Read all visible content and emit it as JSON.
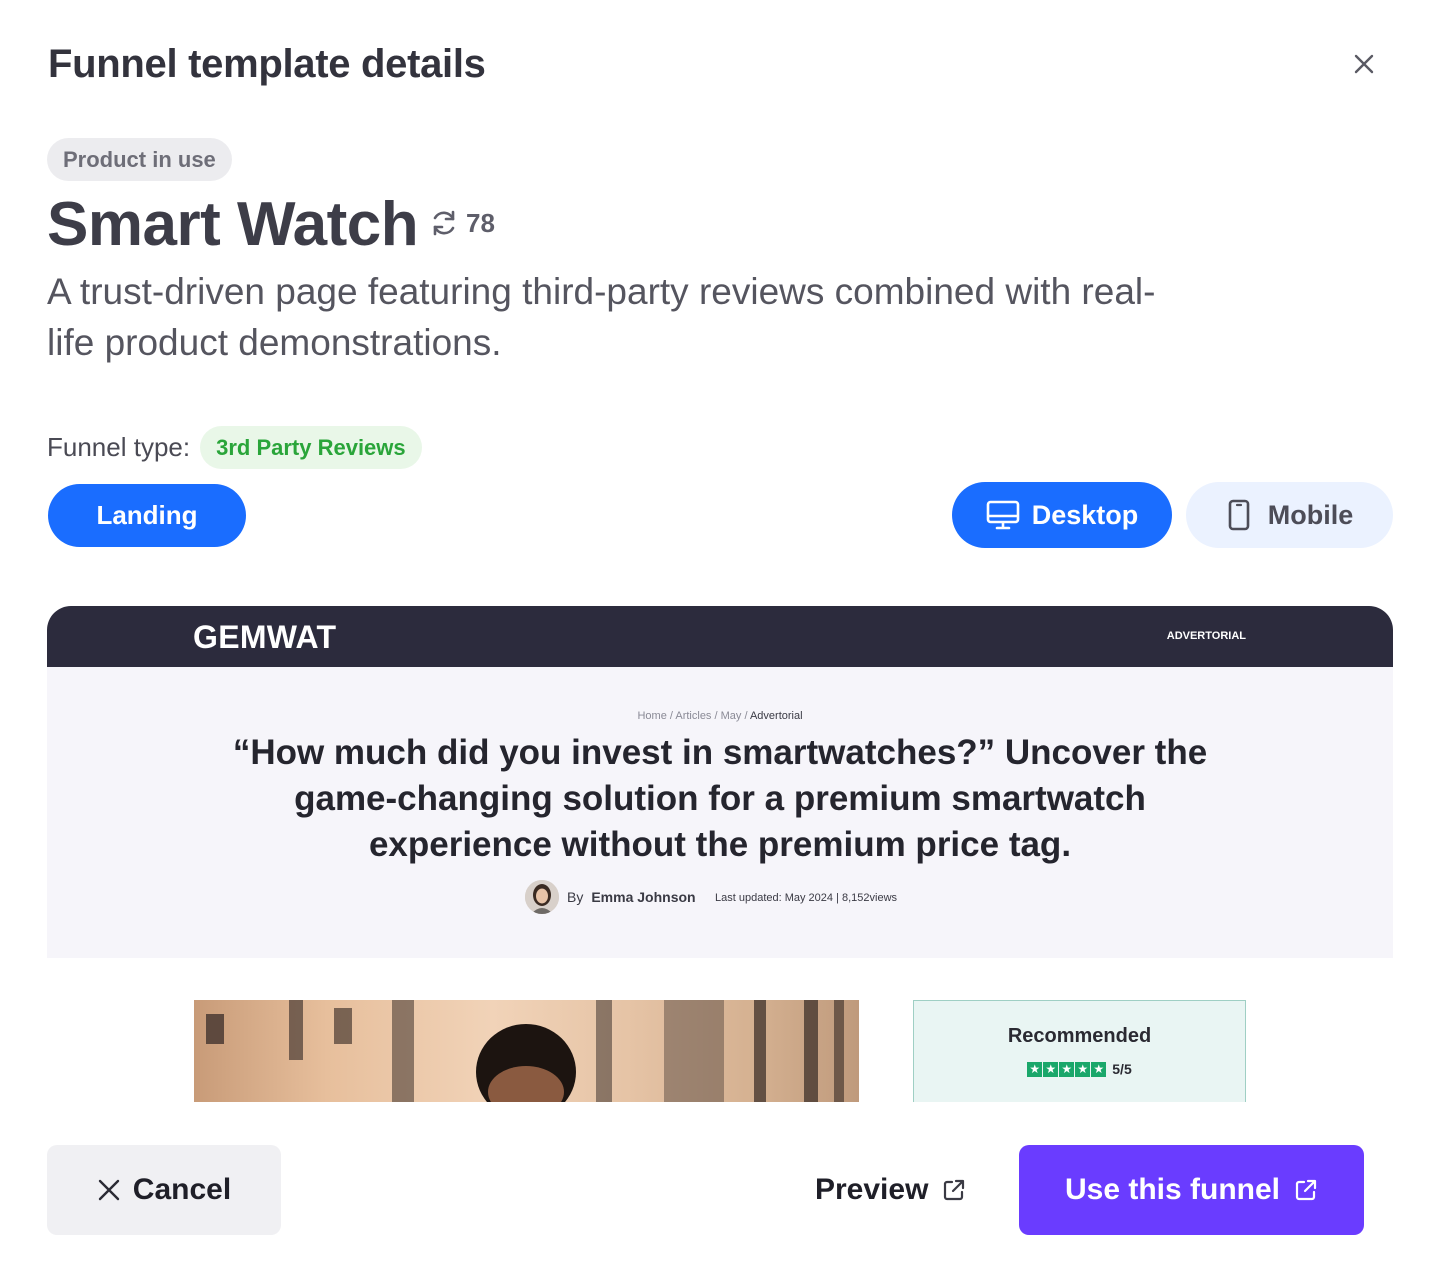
{
  "header": {
    "title": "Funnel template details",
    "close_icon": "close-icon"
  },
  "template": {
    "badge": "Product in use",
    "name": "Smart Watch",
    "uses_icon": "refresh-icon",
    "uses_count": "78",
    "description": "A trust-driven page featuring third-party reviews combined with real-life product demonstrations.",
    "funnel_type_label": "Funnel type:",
    "funnel_type_value": "3rd Party Reviews"
  },
  "controls": {
    "page_tab": "Landing",
    "desktop_label": "Desktop",
    "mobile_label": "Mobile",
    "active_view": "Desktop"
  },
  "preview": {
    "logo": "GEMWAT",
    "tag": "ADVERTORIAL",
    "breadcrumb": [
      "Home",
      "Articles",
      "May",
      "Advertorial"
    ],
    "headline": "“How much did you invest in smartwatches?” Uncover the game-changing solution for a premium smartwatch experience without the premium price tag.",
    "author_prefix": "By",
    "author_name": "Emma Johnson",
    "meta": "Last updated: May 2024 | 8,152views",
    "recommended_title": "Recommended",
    "rating": "5/5",
    "star_count": 5
  },
  "footer": {
    "cancel_label": "Cancel",
    "preview_label": "Preview",
    "use_label": "Use this funnel"
  },
  "colors": {
    "primary_blue": "#1a6dff",
    "purple_cta": "#6a3cff",
    "green_badge": "#2aa53a",
    "nav_dark": "#2c2b3d",
    "star_green": "#1aa76a"
  }
}
